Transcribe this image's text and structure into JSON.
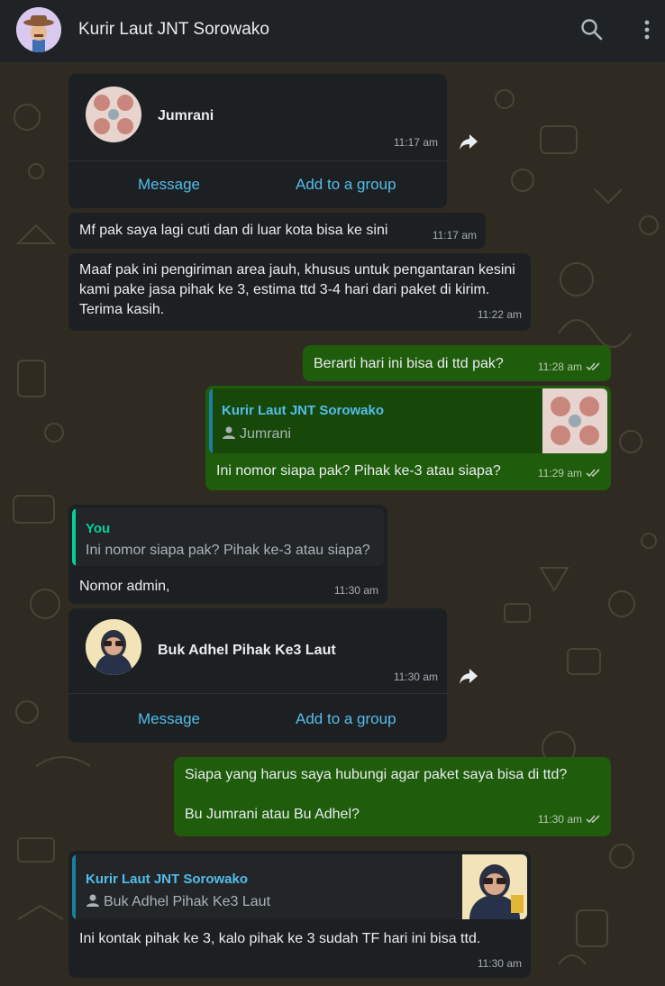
{
  "header": {
    "title": "Kurir Laut JNT Sorowako",
    "search_icon": "search-icon",
    "menu_icon": "more-vertical-icon"
  },
  "messages": [
    {
      "type": "contact",
      "name": "Jumrani",
      "time": "11:17 am",
      "action1": "Message",
      "action2": "Add to a group"
    },
    {
      "type": "text",
      "dir": "in",
      "text": "Mf pak saya lagi cuti dan di luar kota bisa ke sini",
      "time": "11:17 am"
    },
    {
      "type": "text",
      "dir": "in",
      "text": "Maaf pak ini pengiriman area jauh, khusus untuk pengantaran kesini kami pake jasa pihak ke 3, estima ttd 3-4 hari dari paket di kirim. Terima kasih.",
      "time": "11:22 am"
    },
    {
      "type": "text",
      "dir": "out",
      "text": "Berarti hari ini bisa di ttd pak?",
      "time": "11:28 am"
    },
    {
      "type": "reply",
      "dir": "out",
      "quote_name": "Kurir Laut JNT Sorowako",
      "quote_text": "Jumrani",
      "text": "Ini nomor siapa pak? Pihak ke-3 atau siapa?",
      "time": "11:29 am"
    },
    {
      "type": "reply",
      "dir": "in",
      "quote_name": "You",
      "quote_text": "Ini nomor siapa pak? Pihak ke-3 atau siapa?",
      "text": "Nomor admin,",
      "time": "11:30 am"
    },
    {
      "type": "contact",
      "name": "Buk Adhel Pihak Ke3 Laut",
      "time": "11:30 am",
      "action1": "Message",
      "action2": "Add to a group"
    },
    {
      "type": "text",
      "dir": "out",
      "text": "Siapa yang harus saya hubungi agar paket saya bisa di ttd?\n\nBu Jumrani atau Bu Adhel?",
      "time": "11:30 am"
    },
    {
      "type": "reply",
      "dir": "in",
      "quote_name": "Kurir Laut JNT Sorowako",
      "quote_text": "Buk Adhel Pihak Ke3 Laut",
      "text": "Ini kontak pihak ke 3, kalo pihak ke 3 sudah TF hari ini bisa ttd.",
      "time": "11:30 am"
    }
  ],
  "colors": {
    "header_bg": "#1f2326",
    "incoming_bubble": "#1d2022",
    "outgoing_bubble": "#1f5c0c",
    "link": "#53bdeb",
    "quote_name_blue": "#53bdeb",
    "quote_name_green": "#06cf9c"
  }
}
